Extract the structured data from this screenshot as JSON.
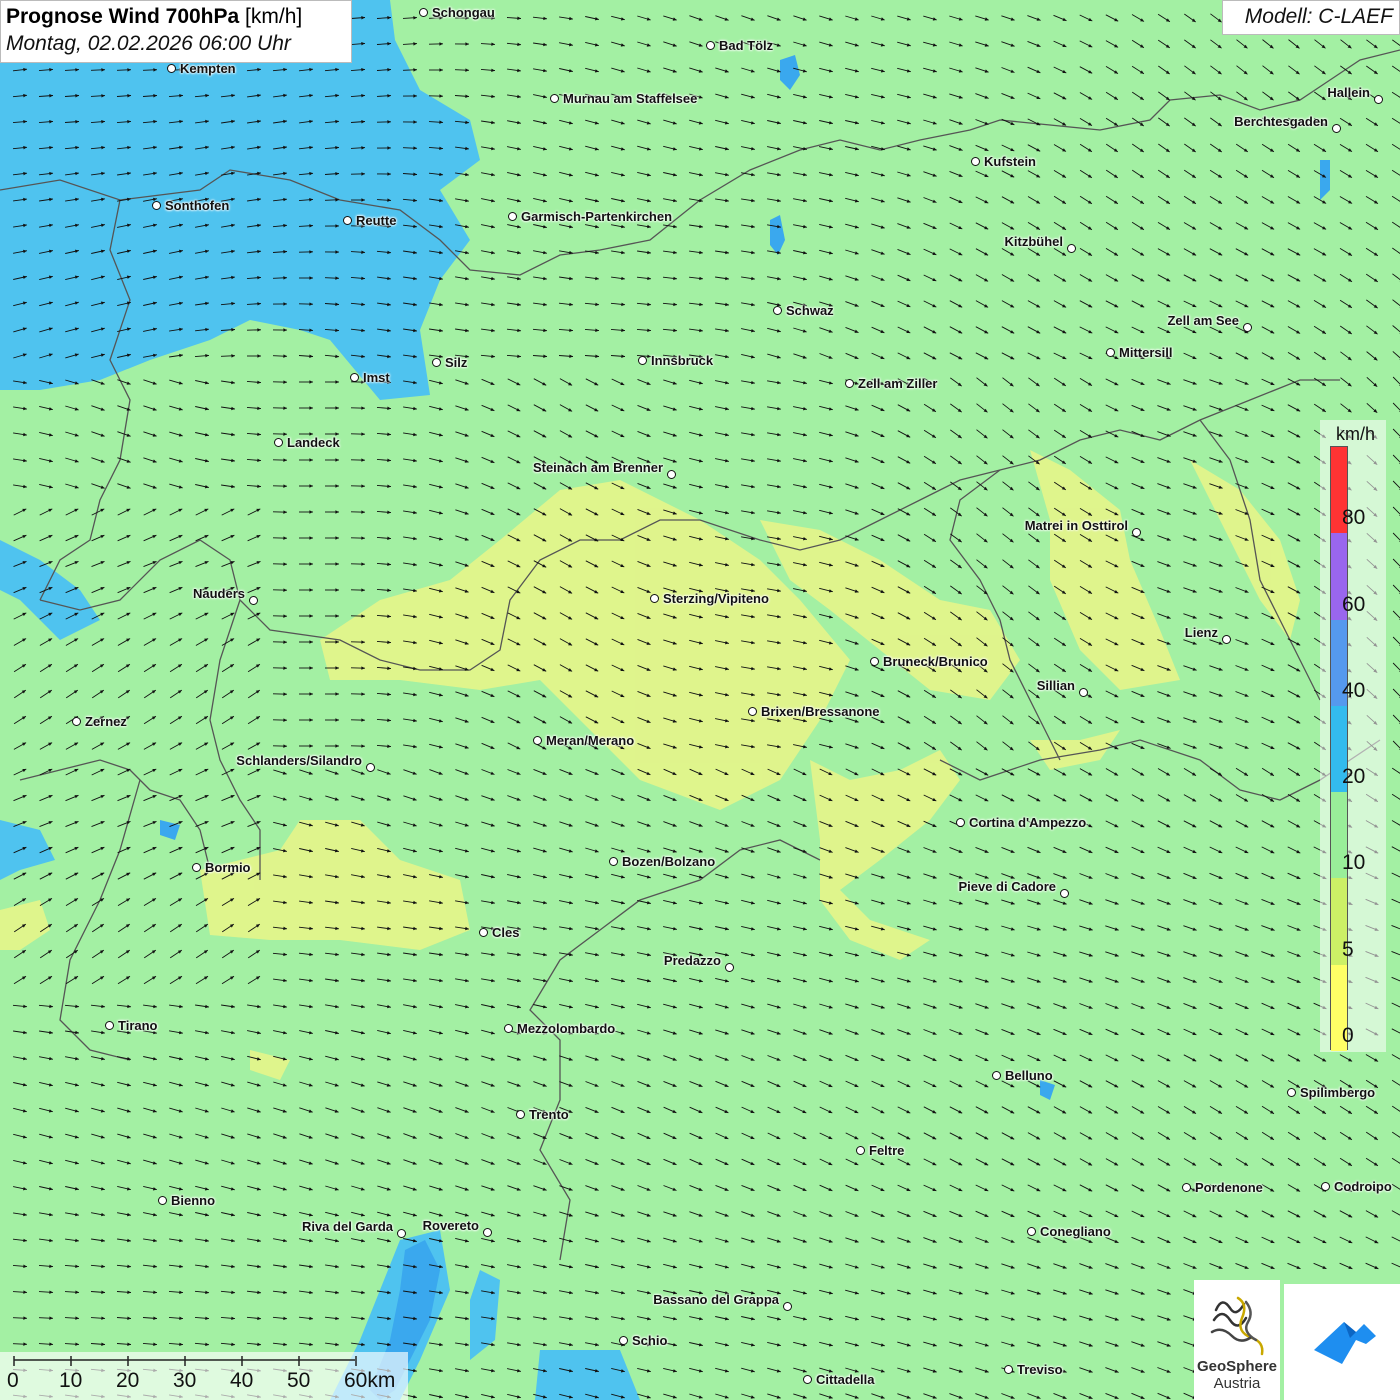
{
  "title": {
    "main": "Prognose Wind 700hPa",
    "unit": "[km/h]",
    "datetime": "Montag, 02.02.2026 06:00 Uhr"
  },
  "model": "Modell: C-LAEF",
  "legend": {
    "unit": "km/h",
    "ticks": [
      "80",
      "60",
      "40",
      "20",
      "10",
      "5",
      "0"
    ],
    "colors": [
      "#ff3333",
      "#9966ee",
      "#5599ee",
      "#33bbee",
      "#99ee99",
      "#ccf066",
      "#ffff66"
    ]
  },
  "scalebar": {
    "ticks": [
      "0",
      "10",
      "20",
      "30",
      "40",
      "50",
      "60km"
    ]
  },
  "logo": {
    "line1": "GeoSphere",
    "line2": "Austria"
  },
  "colors": {
    "land_wind": "#a3f0a3",
    "calm_yellow": "#e6f58a",
    "strong_blue": "#4fc3ef",
    "lake_blue": "#3aa8ee"
  },
  "cities": [
    "Schongau",
    "Bad Tölz",
    "Kempten",
    "Murnau am Staffelsee",
    "Hallein",
    "Berchtesgaden",
    "Kufstein",
    "Sonthofen",
    "Reutte",
    "Garmisch-Partenkirchen",
    "Kitzbühel",
    "Schwaz",
    "Zell am See",
    "Mittersill",
    "Imst",
    "Silz",
    "Innsbruck",
    "Zell am Ziller",
    "Landeck",
    "Steinach am Brenner",
    "Matrei in Osttirol",
    "Nauders",
    "Sterzing/Vipiteno",
    "Lienz",
    "Bruneck/Brunico",
    "Sillian",
    "Zernez",
    "Brixen/Bressanone",
    "Meran/Merano",
    "Schlanders/Silandro",
    "Cortina d'Ampezzo",
    "Bormio",
    "Bozen/Bolzano",
    "Pieve di Cadore",
    "Cles",
    "Predazzo",
    "Tirano",
    "Mezzolombardo",
    "Belluno",
    "Spilimbergo",
    "Trento",
    "Feltre",
    "Bienno",
    "Pordenone",
    "Codroipo",
    "Riva del Garda",
    "Rovereto",
    "Conegliano",
    "Bassano del Grappa",
    "Schio",
    "Treviso",
    "Cittadella"
  ]
}
